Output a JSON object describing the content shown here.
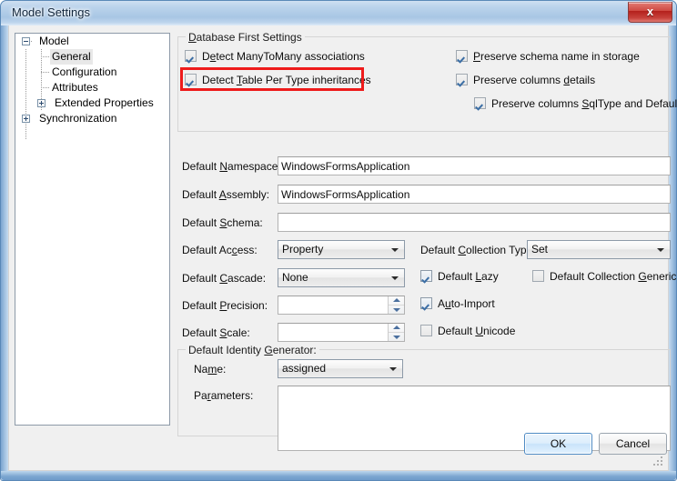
{
  "window": {
    "title": "Model Settings",
    "close_glyph": "x"
  },
  "tree": {
    "nodes": [
      {
        "label": "Model",
        "level": 0,
        "expander": "minus",
        "selected": false
      },
      {
        "label": "General",
        "level": 1,
        "expander": "none",
        "selected": true
      },
      {
        "label": "Configuration",
        "level": 1,
        "expander": "none",
        "selected": false
      },
      {
        "label": "Attributes",
        "level": 1,
        "expander": "none",
        "selected": false
      },
      {
        "label": "Extended Properties",
        "level": 1,
        "expander": "plus",
        "selected": false
      },
      {
        "label": "Synchronization",
        "level": 0,
        "expander": "plus",
        "selected": false
      }
    ]
  },
  "database_first": {
    "group_title": "Database First Settings",
    "checkboxes": [
      {
        "label_before": "D",
        "label_key": "e",
        "label_after": "tect ManyToMany associations",
        "checked": true
      },
      {
        "label_before": "Detect ",
        "label_key": "T",
        "label_after": "able Per Type inheritances",
        "checked": true
      },
      {
        "label_before": "",
        "label_key": "P",
        "label_after": "reserve schema name in storage",
        "checked": true
      },
      {
        "label_before": "Preserve columns ",
        "label_key": "d",
        "label_after": "etails",
        "checked": true
      },
      {
        "label_before": "Preserve columns ",
        "label_key": "S",
        "label_after": "qlType and Default",
        "checked": true
      }
    ]
  },
  "fields": {
    "namespace": {
      "label_before": "Default ",
      "label_key": "N",
      "label_after": "amespace:",
      "value": "WindowsFormsApplication"
    },
    "assembly": {
      "label_before": "Default ",
      "label_key": "A",
      "label_after": "ssembly:",
      "value": "WindowsFormsApplication"
    },
    "schema": {
      "label_before": "Default ",
      "label_key": "S",
      "label_after": "chema:",
      "value": ""
    },
    "access": {
      "label_before": "Default Ac",
      "label_key": "c",
      "label_after": "ess:",
      "value": "Property"
    },
    "cascade": {
      "label_before": "Default ",
      "label_key": "C",
      "label_after": "ascade:",
      "value": "None"
    },
    "precision": {
      "label_before": "Default ",
      "label_key": "P",
      "label_after": "recision:",
      "value": ""
    },
    "scale": {
      "label_before": "Default ",
      "label_key": "S",
      "label_after": "cale:",
      "value": ""
    },
    "collection_type": {
      "label_before": "Default ",
      "label_key": "C",
      "label_after": "ollection Type:",
      "value": "Set"
    }
  },
  "right_checkboxes": {
    "default_lazy": {
      "label_before": "Default ",
      "label_key": "L",
      "label_after": "azy",
      "checked": true
    },
    "auto_import": {
      "label_before": "A",
      "label_key": "u",
      "label_after": "to-Import",
      "checked": true
    },
    "default_unicode": {
      "label_before": "Default ",
      "label_key": "U",
      "label_after": "nicode",
      "checked": false
    },
    "default_collection_generic": {
      "label_before": "Default Collection ",
      "label_key": "G",
      "label_after": "eneric",
      "checked": false
    }
  },
  "identity_generator": {
    "group_title_before": "Default Identity ",
    "group_title_key": "G",
    "group_title_after": "enerator:",
    "name": {
      "label_before": "Na",
      "label_key": "m",
      "label_after": "e:",
      "value": "assigned"
    },
    "parameters": {
      "label_before": "Pa",
      "label_key": "r",
      "label_after": "ameters:",
      "value": ""
    }
  },
  "buttons": {
    "ok": "OK",
    "cancel": "Cancel"
  },
  "colors": {
    "highlight": "#ee1b1b",
    "titlebar_text": "#12263c",
    "close_button": "#b4201c"
  }
}
